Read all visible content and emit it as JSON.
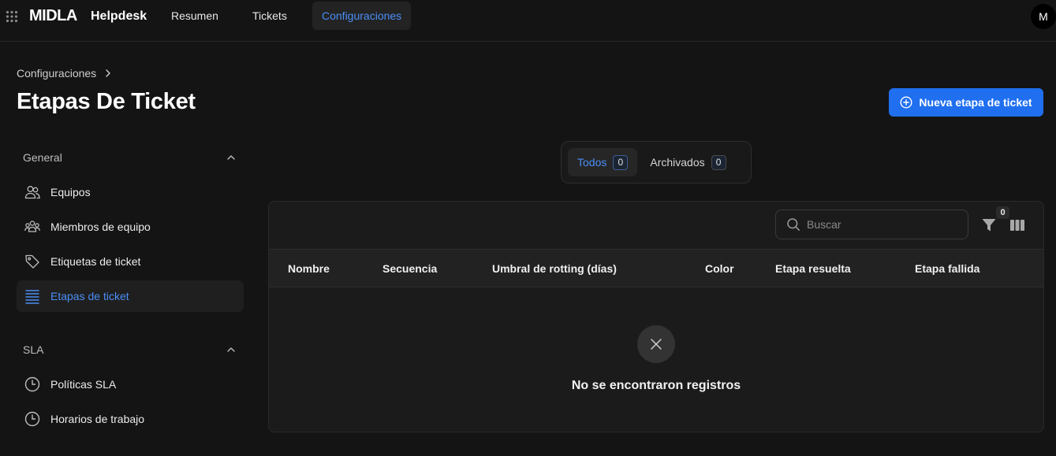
{
  "topbar": {
    "brand": "MIDLA",
    "product": "Helpdesk",
    "nav": [
      {
        "label": "Resumen",
        "active": false
      },
      {
        "label": "Tickets",
        "active": false
      },
      {
        "label": "Configuraciones",
        "active": true
      }
    ],
    "avatar_initial": "M",
    "icons": {
      "apps": "grid-dots-icon"
    }
  },
  "header": {
    "breadcrumb": [
      "Configuraciones"
    ],
    "title": "Etapas De Ticket",
    "primary_button": "Nueva etapa de ticket"
  },
  "sidebar": {
    "sections": [
      {
        "title": "General",
        "expanded": true,
        "items": [
          {
            "label": "Equipos",
            "icon": "users-icon",
            "active": false
          },
          {
            "label": "Miembros de equipo",
            "icon": "team-members-icon",
            "active": false
          },
          {
            "label": "Etiquetas de ticket",
            "icon": "tag-icon",
            "active": false
          },
          {
            "label": "Etapas de ticket",
            "icon": "list-lines-icon",
            "active": true
          }
        ]
      },
      {
        "title": "SLA",
        "expanded": true,
        "items": [
          {
            "label": "Políticas SLA",
            "icon": "clock-icon",
            "active": false
          },
          {
            "label": "Horarios de trabajo",
            "icon": "clock-icon",
            "active": false
          }
        ]
      }
    ]
  },
  "tabs": [
    {
      "label": "Todos",
      "count": "0",
      "active": true
    },
    {
      "label": "Archivados",
      "count": "0",
      "active": false
    }
  ],
  "table": {
    "search_placeholder": "Buscar",
    "filter_count": "0",
    "columns": [
      "Nombre",
      "Secuencia",
      "Umbral de rotting (días)",
      "Color",
      "Etapa resuelta",
      "Etapa fallida"
    ],
    "rows": [],
    "empty_message": "No se encontraron registros"
  },
  "colors": {
    "accent": "#4a8ef7",
    "primary_button": "#1f6ff0",
    "background": "#141414",
    "card": "#1b1b1b"
  }
}
